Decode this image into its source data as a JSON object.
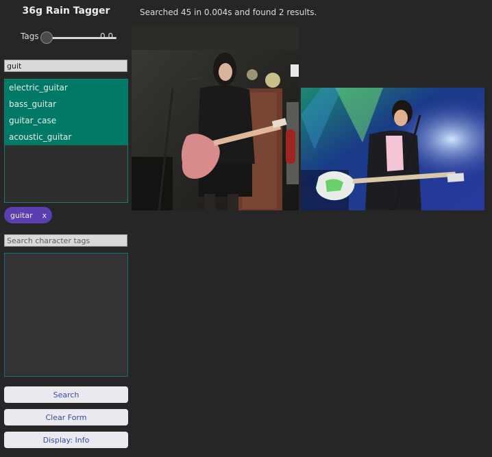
{
  "app": {
    "title": "36g Rain Tagger"
  },
  "slider": {
    "label": "Tags",
    "value": 0.0,
    "value_text": "0.0"
  },
  "tag_search": {
    "value": "guit",
    "suggestions": [
      "electric_guitar",
      "bass_guitar",
      "guitar_case",
      "acoustic_guitar"
    ]
  },
  "selected_tags": [
    {
      "label": "guitar",
      "remove_label": "x"
    }
  ],
  "character_search": {
    "value": "",
    "placeholder": "Search character tags"
  },
  "buttons": {
    "search": "Search",
    "clear": "Clear Form",
    "display": "Display: Info"
  },
  "results": {
    "status": "Searched 45 in 0.004s and found 2 results."
  },
  "colors": {
    "background": "#262626",
    "suggestion_bg": "#007a66",
    "chip_bg": "#5a3fb0",
    "button_bg": "#e9e9ef",
    "button_text": "#3c4a9c"
  }
}
